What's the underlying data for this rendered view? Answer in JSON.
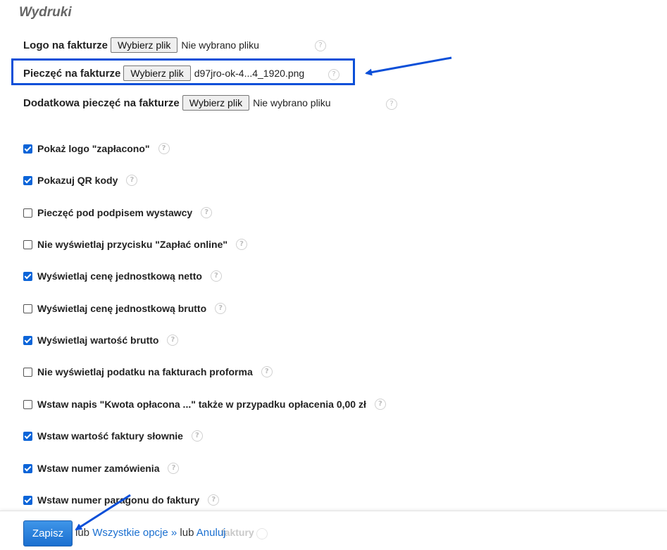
{
  "section": {
    "title": "Wydruki"
  },
  "file_rows": [
    {
      "label": "Logo na fakturze",
      "button": "Wybierz plik",
      "status": "Nie wybrano pliku"
    },
    {
      "label": "Pieczęć na fakturze",
      "button": "Wybierz plik",
      "status": "d97jro-ok-4...4_1920.png"
    },
    {
      "label": "Dodatkowa pieczęć na fakturze",
      "button": "Wybierz plik",
      "status": "Nie wybrano pliku"
    }
  ],
  "options": [
    {
      "label": "Pokaż logo \"zapłacono\"",
      "checked": true
    },
    {
      "label": "Pokazuj QR kody",
      "checked": true
    },
    {
      "label": "Pieczęć pod podpisem wystawcy",
      "checked": false
    },
    {
      "label": "Nie wyświetlaj przycisku \"Zapłać online\"",
      "checked": false
    },
    {
      "label": "Wyświetlaj cenę jednostkową netto",
      "checked": true
    },
    {
      "label": "Wyświetlaj cenę jednostkową brutto",
      "checked": false
    },
    {
      "label": "Wyświetlaj wartość brutto",
      "checked": true
    },
    {
      "label": "Nie wyświetlaj podatku na fakturach proforma",
      "checked": false
    },
    {
      "label": "Wstaw napis \"Kwota opłacona ...\" także w przypadku opłacenia 0,00 zł",
      "checked": false
    },
    {
      "label": "Wstaw wartość faktury słownie",
      "checked": true
    },
    {
      "label": "Wstaw numer zamówienia",
      "checked": true
    },
    {
      "label": "Wstaw numer paragonu do faktury",
      "checked": true
    }
  ],
  "help_icon": "?",
  "footer": {
    "save_label": "Zapisz",
    "or_text_1": "lub",
    "all_options_link": "Wszystkie opcje »",
    "or_text_2": "lub",
    "cancel_link": "Anuluj",
    "obscured_text": "faktury"
  },
  "colors": {
    "accent": "#1a6fd0",
    "highlight_border": "#0b4fd8",
    "checkbox_checked": "#0b64d8"
  }
}
